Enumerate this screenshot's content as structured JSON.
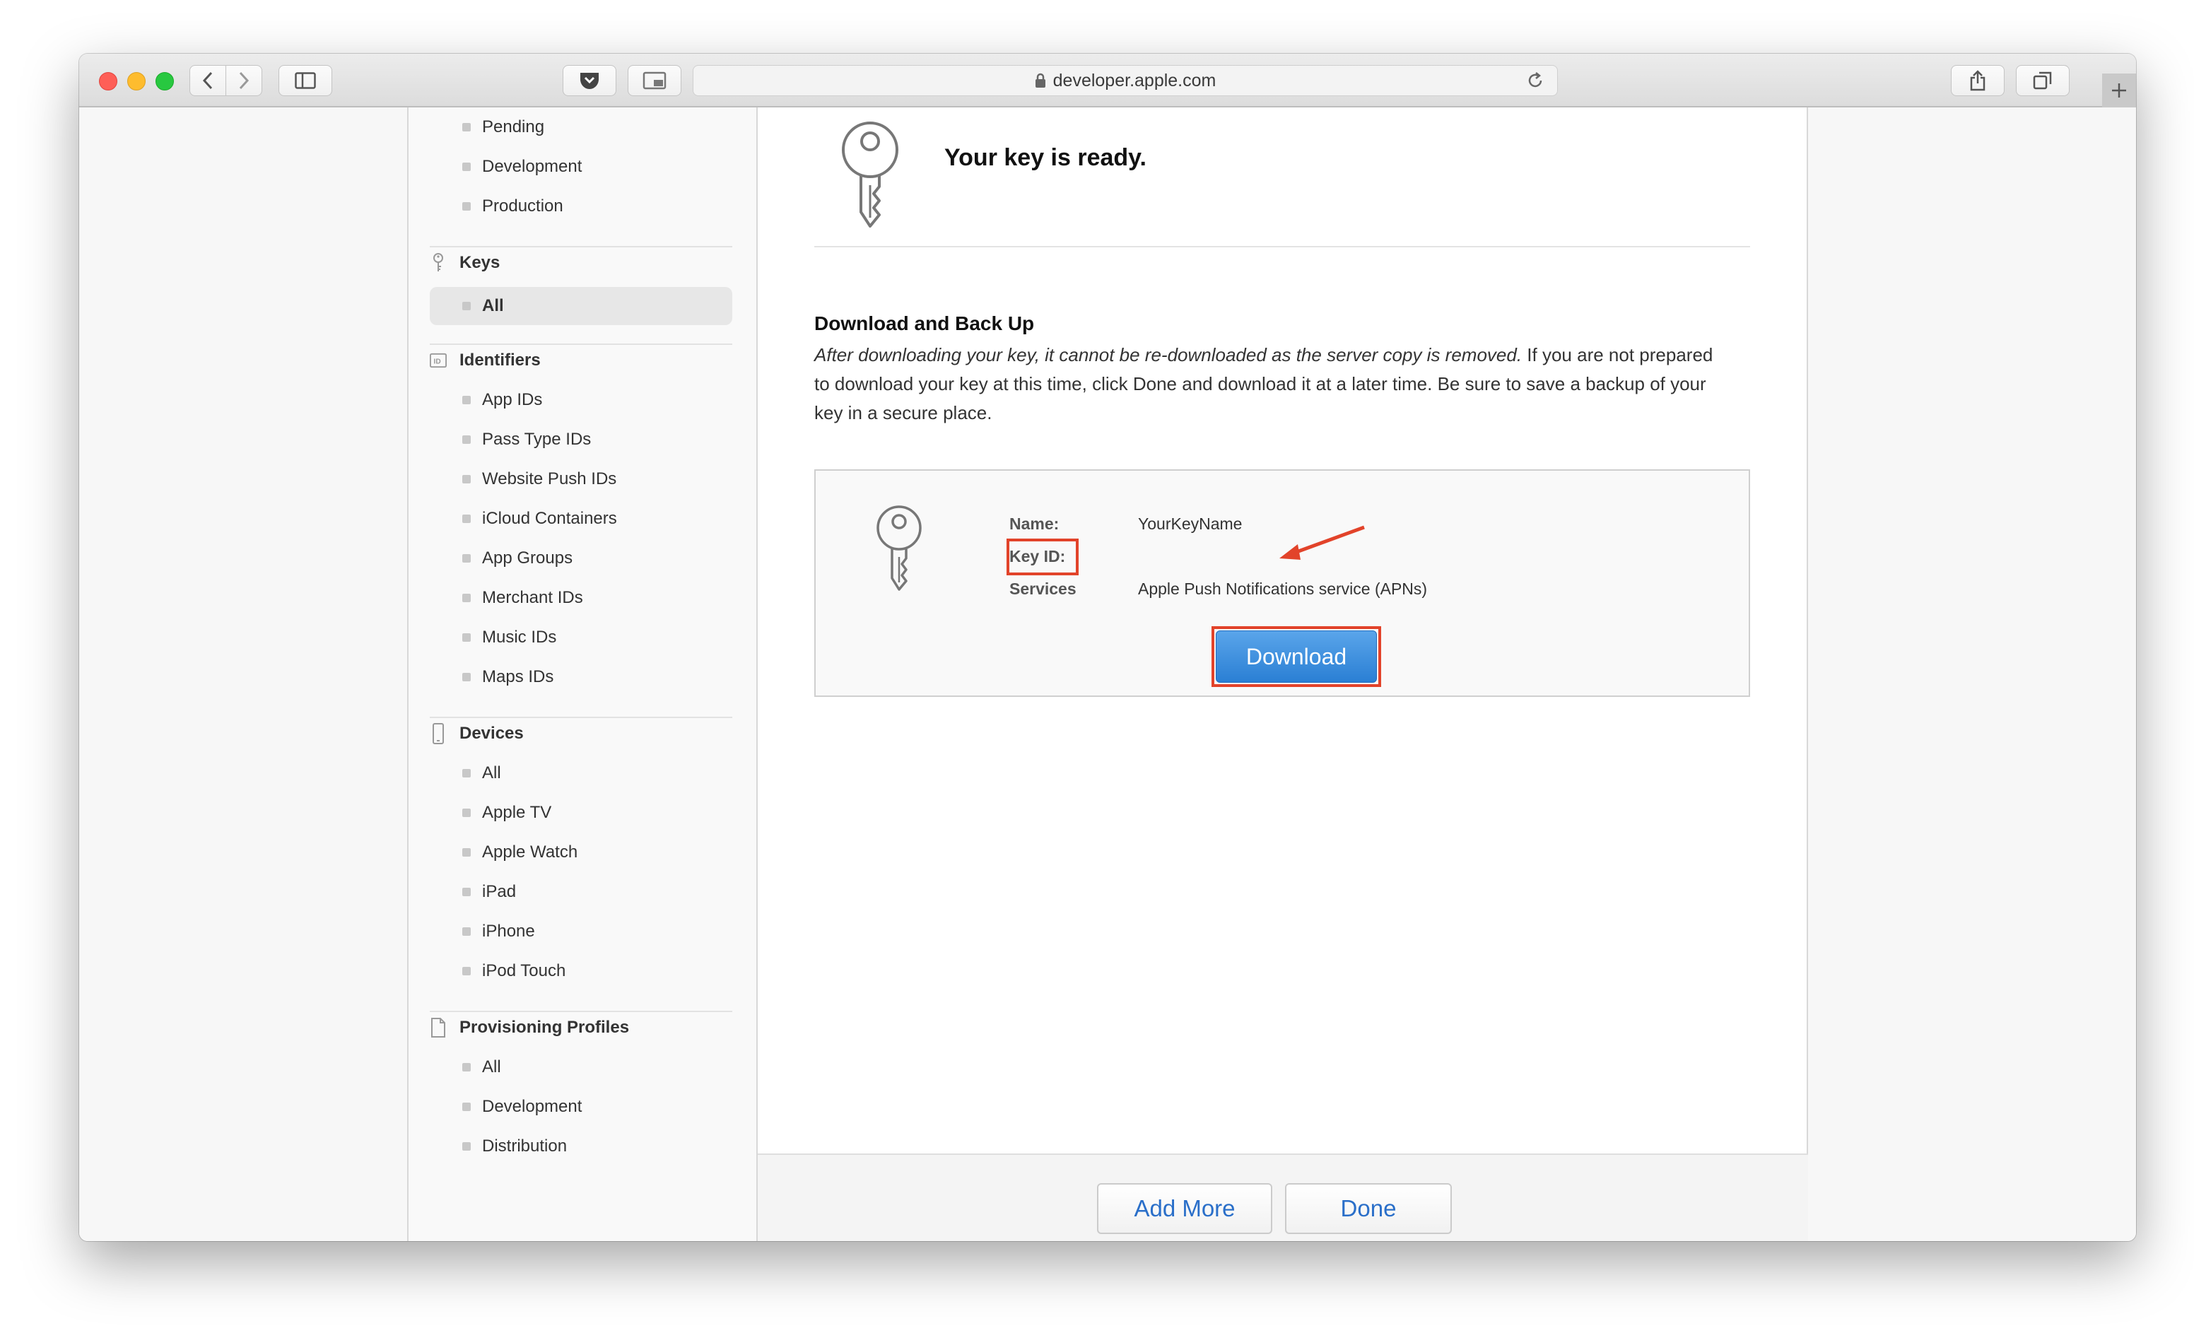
{
  "browser": {
    "url": "developer.apple.com"
  },
  "sidebar": {
    "top_items": [
      "Pending",
      "Development",
      "Production"
    ],
    "keys": {
      "heading": "Keys",
      "items": [
        "All"
      ]
    },
    "identifiers": {
      "heading": "Identifiers",
      "items": [
        "App IDs",
        "Pass Type IDs",
        "Website Push IDs",
        "iCloud Containers",
        "App Groups",
        "Merchant IDs",
        "Music IDs",
        "Maps IDs"
      ]
    },
    "devices": {
      "heading": "Devices",
      "items": [
        "All",
        "Apple TV",
        "Apple Watch",
        "iPad",
        "iPhone",
        "iPod Touch"
      ]
    },
    "profiles": {
      "heading": "Provisioning Profiles",
      "items": [
        "All",
        "Development",
        "Distribution"
      ]
    }
  },
  "main": {
    "title": "Your key is ready.",
    "section_title": "Download and Back Up",
    "section_body_italic": "After downloading your key, it cannot be re-downloaded as the server copy is removed.",
    "section_body_rest": " If you are not prepared to download your key at this time, click Done and download it at a later time. Be sure to save a backup of your key in a secure place.",
    "key": {
      "name_label": "Name:",
      "name_value": "YourKeyName",
      "keyid_label": "Key ID:",
      "services_label": "Services",
      "services_value": "Apple Push Notifications service (APNs)"
    },
    "download_label": "Download",
    "footer": {
      "add_more_label": "Add More",
      "done_label": "Done"
    }
  },
  "colors": {
    "accent": "#2a7fd4",
    "highlight": "#e2432a",
    "link": "#2a6fc9"
  }
}
